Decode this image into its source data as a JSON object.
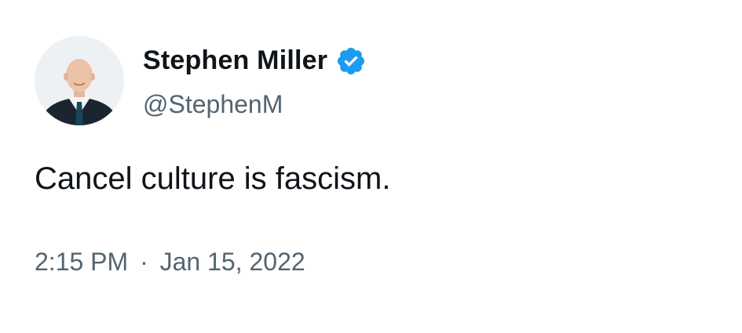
{
  "tweet": {
    "author": {
      "display_name": "Stephen Miller",
      "handle": "@StephenM",
      "verified_icon": "verified-badge-icon",
      "avatar_icon": "profile-photo"
    },
    "text": "Cancel culture is fascism.",
    "time": "2:15 PM",
    "separator": "·",
    "date": "Jan 15, 2022"
  },
  "colors": {
    "text_primary": "#0f1419",
    "text_secondary": "#536471",
    "verified_blue": "#1d9bf0",
    "background": "#ffffff"
  }
}
